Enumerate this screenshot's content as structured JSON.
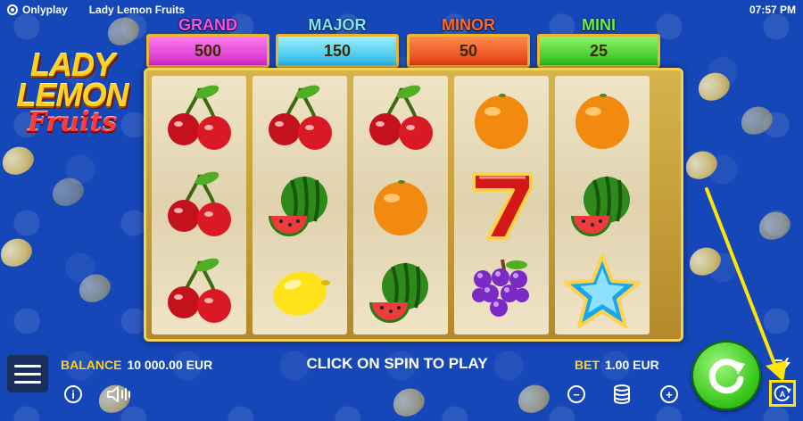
{
  "topbar": {
    "brand": "Onlyplay",
    "game_title": "Lady Lemon Fruits",
    "clock": "07:57 PM"
  },
  "logo": {
    "line1": "LADY",
    "line2": "LEMON",
    "line3": "Fruits"
  },
  "jackpots": [
    {
      "label": "GRAND",
      "value": "500",
      "label_color": "#ff4fe0",
      "box_color": "#e23ad6"
    },
    {
      "label": "MAJOR",
      "value": "150",
      "label_color": "#7fe6ff",
      "box_color": "#38c8f0"
    },
    {
      "label": "MINOR",
      "value": "50",
      "label_color": "#ff6a2a",
      "box_color": "#ee4c1c"
    },
    {
      "label": "MINI",
      "value": "25",
      "label_color": "#6af04a",
      "box_color": "#3ccf22"
    }
  ],
  "reels": [
    [
      "cherry",
      "cherry",
      "cherry"
    ],
    [
      "cherry",
      "watermelon",
      "lemon"
    ],
    [
      "cherry",
      "orange",
      "watermelon"
    ],
    [
      "orange",
      "seven",
      "grapes"
    ],
    [
      "orange",
      "watermelon",
      "star"
    ]
  ],
  "bottom": {
    "balance_label": "BALANCE",
    "balance_value": "10 000.00 EUR",
    "message": "CLICK ON SPIN TO PLAY",
    "bet_label": "BET",
    "bet_value": "1.00 EUR",
    "info_icon": "info-icon",
    "sound_icon": "sound-icon",
    "minus_icon": "minus-icon",
    "coins_icon": "coins-icon",
    "plus_icon": "plus-icon",
    "auto_label": "A"
  },
  "colors": {
    "background": "#1547b8",
    "accent_yellow": "#ffd01f",
    "spin_green": "#3cc91f",
    "highlight": "#ffe600"
  }
}
